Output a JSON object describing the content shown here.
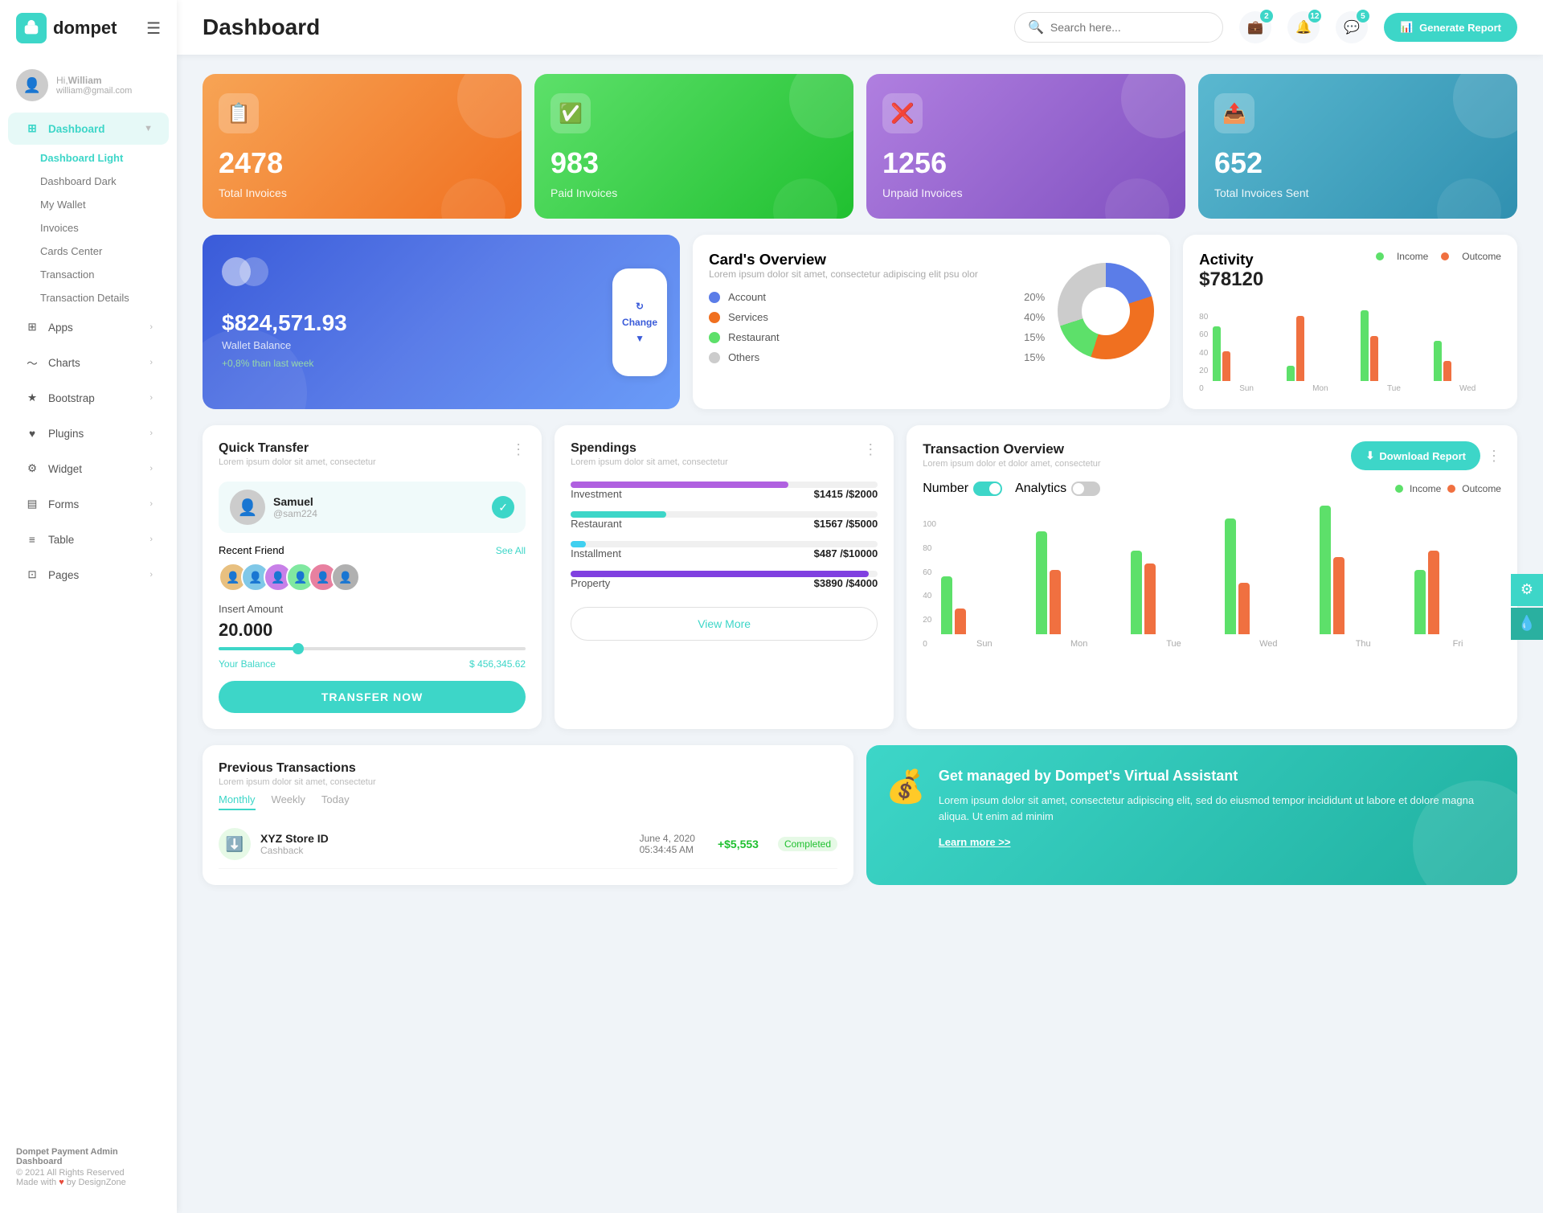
{
  "app": {
    "logo": "dompet",
    "logo_icon": "💼"
  },
  "user": {
    "greeting": "Hi,",
    "name": "William",
    "email": "william@gmail.com"
  },
  "header": {
    "title": "Dashboard",
    "search_placeholder": "Search here...",
    "generate_btn": "Generate Report",
    "notification_count": "2",
    "alert_count": "12",
    "message_count": "5"
  },
  "stats": [
    {
      "value": "2478",
      "label": "Total Invoices",
      "icon": "📋",
      "color": "orange"
    },
    {
      "value": "983",
      "label": "Paid Invoices",
      "icon": "✅",
      "color": "green"
    },
    {
      "value": "1256",
      "label": "Unpaid Invoices",
      "icon": "❌",
      "color": "purple"
    },
    {
      "value": "652",
      "label": "Total Invoices Sent",
      "icon": "📤",
      "color": "teal"
    }
  ],
  "wallet": {
    "amount": "$824,571.93",
    "label": "Wallet Balance",
    "change": "+0,8% than last week",
    "change_btn": "Change"
  },
  "cards_overview": {
    "title": "Card's Overview",
    "subtitle": "Lorem ipsum dolor sit amet, consectetur adipiscing elit psu olor",
    "items": [
      {
        "label": "Account",
        "pct": "20%",
        "color": "#5b7de8"
      },
      {
        "label": "Services",
        "pct": "40%",
        "color": "#f07020"
      },
      {
        "label": "Restaurant",
        "pct": "15%",
        "color": "#5de06a"
      },
      {
        "label": "Others",
        "pct": "15%",
        "color": "#ccc"
      }
    ]
  },
  "activity": {
    "title": "Activity",
    "amount": "$78120",
    "income_label": "Income",
    "outcome_label": "Outcome",
    "bars": [
      {
        "day": "Sun",
        "income": 55,
        "outcome": 30
      },
      {
        "day": "Mon",
        "income": 15,
        "outcome": 65
      },
      {
        "day": "Tue",
        "income": 70,
        "outcome": 45
      },
      {
        "day": "Wed",
        "income": 40,
        "outcome": 20
      }
    ]
  },
  "quick_transfer": {
    "title": "Quick Transfer",
    "subtitle": "Lorem ipsum dolor sit amet, consectetur",
    "user": {
      "name": "Samuel",
      "handle": "@sam224"
    },
    "recent_label": "Recent Friend",
    "see_all": "See All",
    "insert_amount_label": "Insert Amount",
    "amount": "20.000",
    "balance_label": "Your Balance",
    "balance": "$ 456,345.62",
    "transfer_btn": "TRANSFER NOW"
  },
  "spendings": {
    "title": "Spendings",
    "subtitle": "Lorem ipsum dolor sit amet, consectetur",
    "items": [
      {
        "name": "Investment",
        "amount": "$1415",
        "max": "$2000",
        "pct": 71,
        "color": "#b060e0"
      },
      {
        "name": "Restaurant",
        "amount": "$1567",
        "max": "$5000",
        "pct": 31,
        "color": "#3dd6c8"
      },
      {
        "name": "Installment",
        "amount": "$487",
        "max": "$10000",
        "pct": 5,
        "color": "#40d0f0"
      },
      {
        "name": "Property",
        "amount": "$3890",
        "max": "$4000",
        "pct": 97,
        "color": "#8040e0"
      }
    ],
    "view_more": "View More"
  },
  "tx_overview": {
    "title": "Transaction Overview",
    "subtitle": "Lorem ipsum dolor et dolor amet, consectetur",
    "download_btn": "Download Report",
    "number_label": "Number",
    "analytics_label": "Analytics",
    "income_label": "Income",
    "outcome_label": "Outcome",
    "bars": [
      {
        "day": "Sun",
        "income": 45,
        "outcome": 20
      },
      {
        "day": "Mon",
        "income": 80,
        "outcome": 50
      },
      {
        "day": "Tue",
        "income": 65,
        "outcome": 55
      },
      {
        "day": "Wed",
        "income": 90,
        "outcome": 40
      },
      {
        "day": "Thu",
        "income": 100,
        "outcome": 60
      },
      {
        "day": "Fri",
        "income": 50,
        "outcome": 65
      }
    ]
  },
  "prev_transactions": {
    "title": "Previous Transactions",
    "subtitle": "Lorem ipsum dolor sit amet, consectetur",
    "tabs": [
      "Monthly",
      "Weekly",
      "Today"
    ],
    "active_tab": "Monthly",
    "rows": [
      {
        "name": "XYZ Store ID",
        "type": "Cashback",
        "date": "June 4, 2020",
        "time": "05:34:45 AM",
        "amount": "+$5,553",
        "status": "Completed",
        "icon": "⬇️",
        "icon_bg": "#e6f9e6"
      }
    ]
  },
  "virtual_assistant": {
    "title": "Get managed by Dompet's Virtual Assistant",
    "description": "Lorem ipsum dolor sit amet, consectetur adipiscing elit, sed do eiusmod tempor incididunt ut labore et dolore magna aliqua. Ut enim ad minim",
    "learn_more": "Learn more >>",
    "icon": "💰"
  },
  "sidebar": {
    "nav_items": [
      {
        "label": "Dashboard",
        "icon": "grid",
        "active": true,
        "has_arrow": true
      },
      {
        "label": "Apps",
        "icon": "apps",
        "active": false,
        "has_arrow": true
      },
      {
        "label": "Charts",
        "icon": "chart",
        "active": false,
        "has_arrow": true
      },
      {
        "label": "Bootstrap",
        "icon": "star",
        "active": false,
        "has_arrow": true
      },
      {
        "label": "Plugins",
        "icon": "heart",
        "active": false,
        "has_arrow": true
      },
      {
        "label": "Widget",
        "icon": "gear",
        "active": false,
        "has_arrow": true
      },
      {
        "label": "Forms",
        "icon": "form",
        "active": false,
        "has_arrow": true
      },
      {
        "label": "Table",
        "icon": "table",
        "active": false,
        "has_arrow": true
      },
      {
        "label": "Pages",
        "icon": "pages",
        "active": false,
        "has_arrow": true
      }
    ],
    "sub_items": [
      {
        "label": "Dashboard Light",
        "active": true
      },
      {
        "label": "Dashboard Dark",
        "active": false
      },
      {
        "label": "My Wallet",
        "active": false
      },
      {
        "label": "Invoices",
        "active": false
      },
      {
        "label": "Cards Center",
        "active": false
      },
      {
        "label": "Transaction",
        "active": false
      },
      {
        "label": "Transaction Details",
        "active": false
      }
    ],
    "footer": {
      "title": "Dompet Payment Admin Dashboard",
      "copy": "© 2021 All Rights Reserved",
      "made_with": "Made with",
      "by": "by DesignZone"
    }
  }
}
